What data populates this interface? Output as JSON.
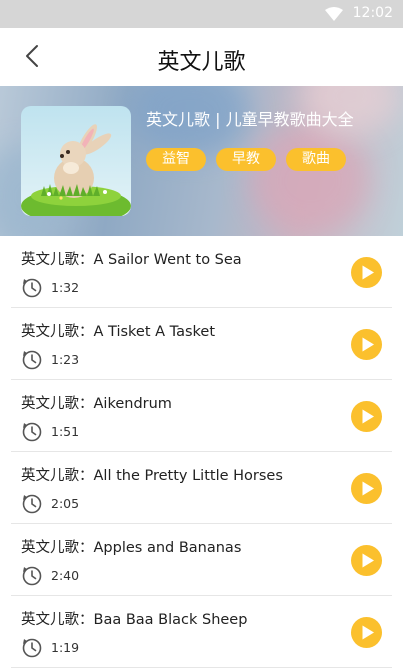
{
  "status": {
    "time": "12:02"
  },
  "header": {
    "title": "英文儿歌"
  },
  "album": {
    "title": "英文儿歌 | 儿童早教歌曲大全",
    "tags": [
      "益智",
      "早教",
      "歌曲"
    ]
  },
  "songs": [
    {
      "title": "英文儿歌：A Sailor Went to Sea",
      "duration": "1:32"
    },
    {
      "title": "英文儿歌：A Tisket A Tasket",
      "duration": "1:23"
    },
    {
      "title": "英文儿歌：Aikendrum",
      "duration": "1:51"
    },
    {
      "title": "英文儿歌：All the Pretty Little Horses",
      "duration": "2:05"
    },
    {
      "title": "英文儿歌：Apples and Bananas",
      "duration": "2:40"
    },
    {
      "title": "英文儿歌：Baa Baa Black Sheep",
      "duration": "1:19"
    }
  ],
  "colors": {
    "accent": "#fbc02d",
    "status_bar": "#d6d6d6"
  },
  "icons": {
    "wifi": "wifi-icon",
    "back": "back-chevron-icon",
    "clock": "clock-icon",
    "play": "play-icon"
  }
}
